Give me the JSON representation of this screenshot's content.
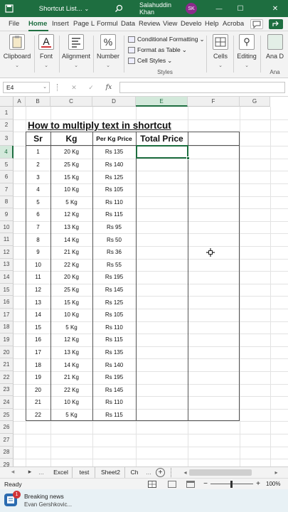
{
  "titlebar": {
    "filename": "Shortcut List...",
    "user": "Salahuddin Khan",
    "initials": "SK",
    "minimize": "—",
    "maximize": "☐",
    "close": "✕"
  },
  "ribbon_tabs": [
    "File",
    "Home",
    "Insert",
    "Page La",
    "Formul",
    "Data",
    "Review",
    "View",
    "Develo",
    "Help",
    "Acroba"
  ],
  "ribbon": {
    "clipboard": "Clipboard",
    "font": "Font",
    "alignment": "Alignment",
    "number": "Number",
    "conditional_formatting": "Conditional Formatting",
    "format_as_table": "Format as Table",
    "cell_styles": "Cell Styles",
    "styles_group": "Styles",
    "cells": "Cells",
    "editing": "Editing",
    "analyze": "Ana D",
    "analyze_group": "Ana",
    "dropdown": "⌄",
    "percent_glyph": "%",
    "font_glyph": "A",
    "search_glyph": "⚲"
  },
  "formula_bar": {
    "name_box": "E4",
    "cancel": "✕",
    "enter": "✓",
    "fx": "fx",
    "value": ""
  },
  "columns": [
    "A",
    "B",
    "C",
    "D",
    "E",
    "F",
    "G"
  ],
  "rows": [
    "1",
    "2",
    "3",
    "4",
    "5",
    "6",
    "7",
    "8",
    "9",
    "10",
    "11",
    "12",
    "13",
    "14",
    "15",
    "16",
    "17",
    "18",
    "19",
    "20",
    "21",
    "22",
    "23",
    "24",
    "25",
    "26",
    "27",
    "28",
    "29",
    "30"
  ],
  "sheet": {
    "title": "How to multiply text in shortcut",
    "headers": [
      "Sr",
      "Kg",
      "Per Kg Price",
      "Total Price"
    ],
    "data": [
      [
        "1",
        "20 Kg",
        "Rs 135"
      ],
      [
        "2",
        "25 Kg",
        "Rs 140"
      ],
      [
        "3",
        "15 Kg",
        "Rs 125"
      ],
      [
        "4",
        "10 Kg",
        "Rs 105"
      ],
      [
        "5",
        "5 Kg",
        "Rs 110"
      ],
      [
        "6",
        "12 Kg",
        "Rs 115"
      ],
      [
        "7",
        "13 Kg",
        "Rs 95"
      ],
      [
        "8",
        "14 Kg",
        "Rs 50"
      ],
      [
        "9",
        "21 Kg",
        "Rs 36"
      ],
      [
        "10",
        "22 Kg",
        "Rs 55"
      ],
      [
        "11",
        "20 Kg",
        "Rs 195"
      ],
      [
        "12",
        "25 Kg",
        "Rs 145"
      ],
      [
        "13",
        "15 Kg",
        "Rs 125"
      ],
      [
        "14",
        "10 Kg",
        "Rs 105"
      ],
      [
        "15",
        "5 Kg",
        "Rs 110"
      ],
      [
        "16",
        "12 Kg",
        "Rs 115"
      ],
      [
        "17",
        "13 Kg",
        "Rs 135"
      ],
      [
        "18",
        "14 Kg",
        "Rs 140"
      ],
      [
        "19",
        "21 Kg",
        "Rs 195"
      ],
      [
        "20",
        "22 Kg",
        "Rs 145"
      ],
      [
        "21",
        "10 Kg",
        "Rs 110"
      ],
      [
        "22",
        "5 Kg",
        "Rs 115"
      ]
    ]
  },
  "sheet_tabs": [
    "Excel",
    "test",
    "Sheet2",
    "Ch"
  ],
  "sheet_nav": {
    "prev": "◂",
    "next": "▸",
    "more": "...",
    "add": "+",
    "scroll_left": "◂",
    "scroll_right": "▸"
  },
  "status": {
    "ready": "Ready",
    "zoom": "100%",
    "zoom_minus": "−",
    "zoom_plus": "+"
  },
  "notification": {
    "title": "Breaking news",
    "subtitle": "Evan Gershkovic...",
    "badge": "1"
  },
  "colors": {
    "excel_green": "#1e6e40",
    "selection_fill": "#d3e9db",
    "badge_red": "#d13438",
    "avatar": "#8b2b8c"
  }
}
